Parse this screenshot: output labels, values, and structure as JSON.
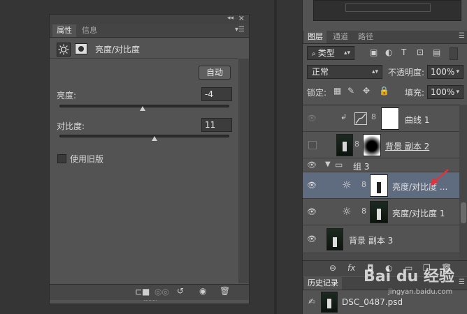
{
  "properties_panel": {
    "tabs": [
      "属性",
      "信息"
    ],
    "header_title": "亮度/对比度",
    "auto_button": "自动",
    "brightness": {
      "label": "亮度:",
      "value": "-4",
      "slider_fraction": 0.49
    },
    "contrast": {
      "label": "对比度:",
      "value": "11",
      "slider_fraction": 0.56
    },
    "legacy_checkbox": {
      "label": "使用旧版",
      "checked": false
    }
  },
  "layers_panel": {
    "tabs": [
      "图层",
      "通道",
      "路径"
    ],
    "filter_kind": "类型",
    "blend_mode": "正常",
    "opacity_label": "不透明度:",
    "opacity_value": "100%",
    "lock_label": "锁定:",
    "fill_label": "填充:",
    "fill_value": "100%",
    "layers": [
      {
        "name": "曲线 1",
        "visible": false,
        "type": "adjustment-curves"
      },
      {
        "name": "背景 副本 2",
        "visible": false,
        "type": "image-masked"
      },
      {
        "name": "组 3",
        "visible": true,
        "type": "group"
      },
      {
        "name": "亮度/对比度 ...",
        "visible": true,
        "type": "adjustment-brightness",
        "selected": true
      },
      {
        "name": "亮度/对比度 1",
        "visible": true,
        "type": "adjustment-brightness"
      },
      {
        "name": "背景 副本 3",
        "visible": true,
        "type": "image"
      }
    ]
  },
  "history_panel": {
    "title": "历史记录",
    "item": "DSC_0487.psd"
  },
  "watermark": {
    "text": "Bai du 经验",
    "sub": "jingyan.baidu.com"
  }
}
